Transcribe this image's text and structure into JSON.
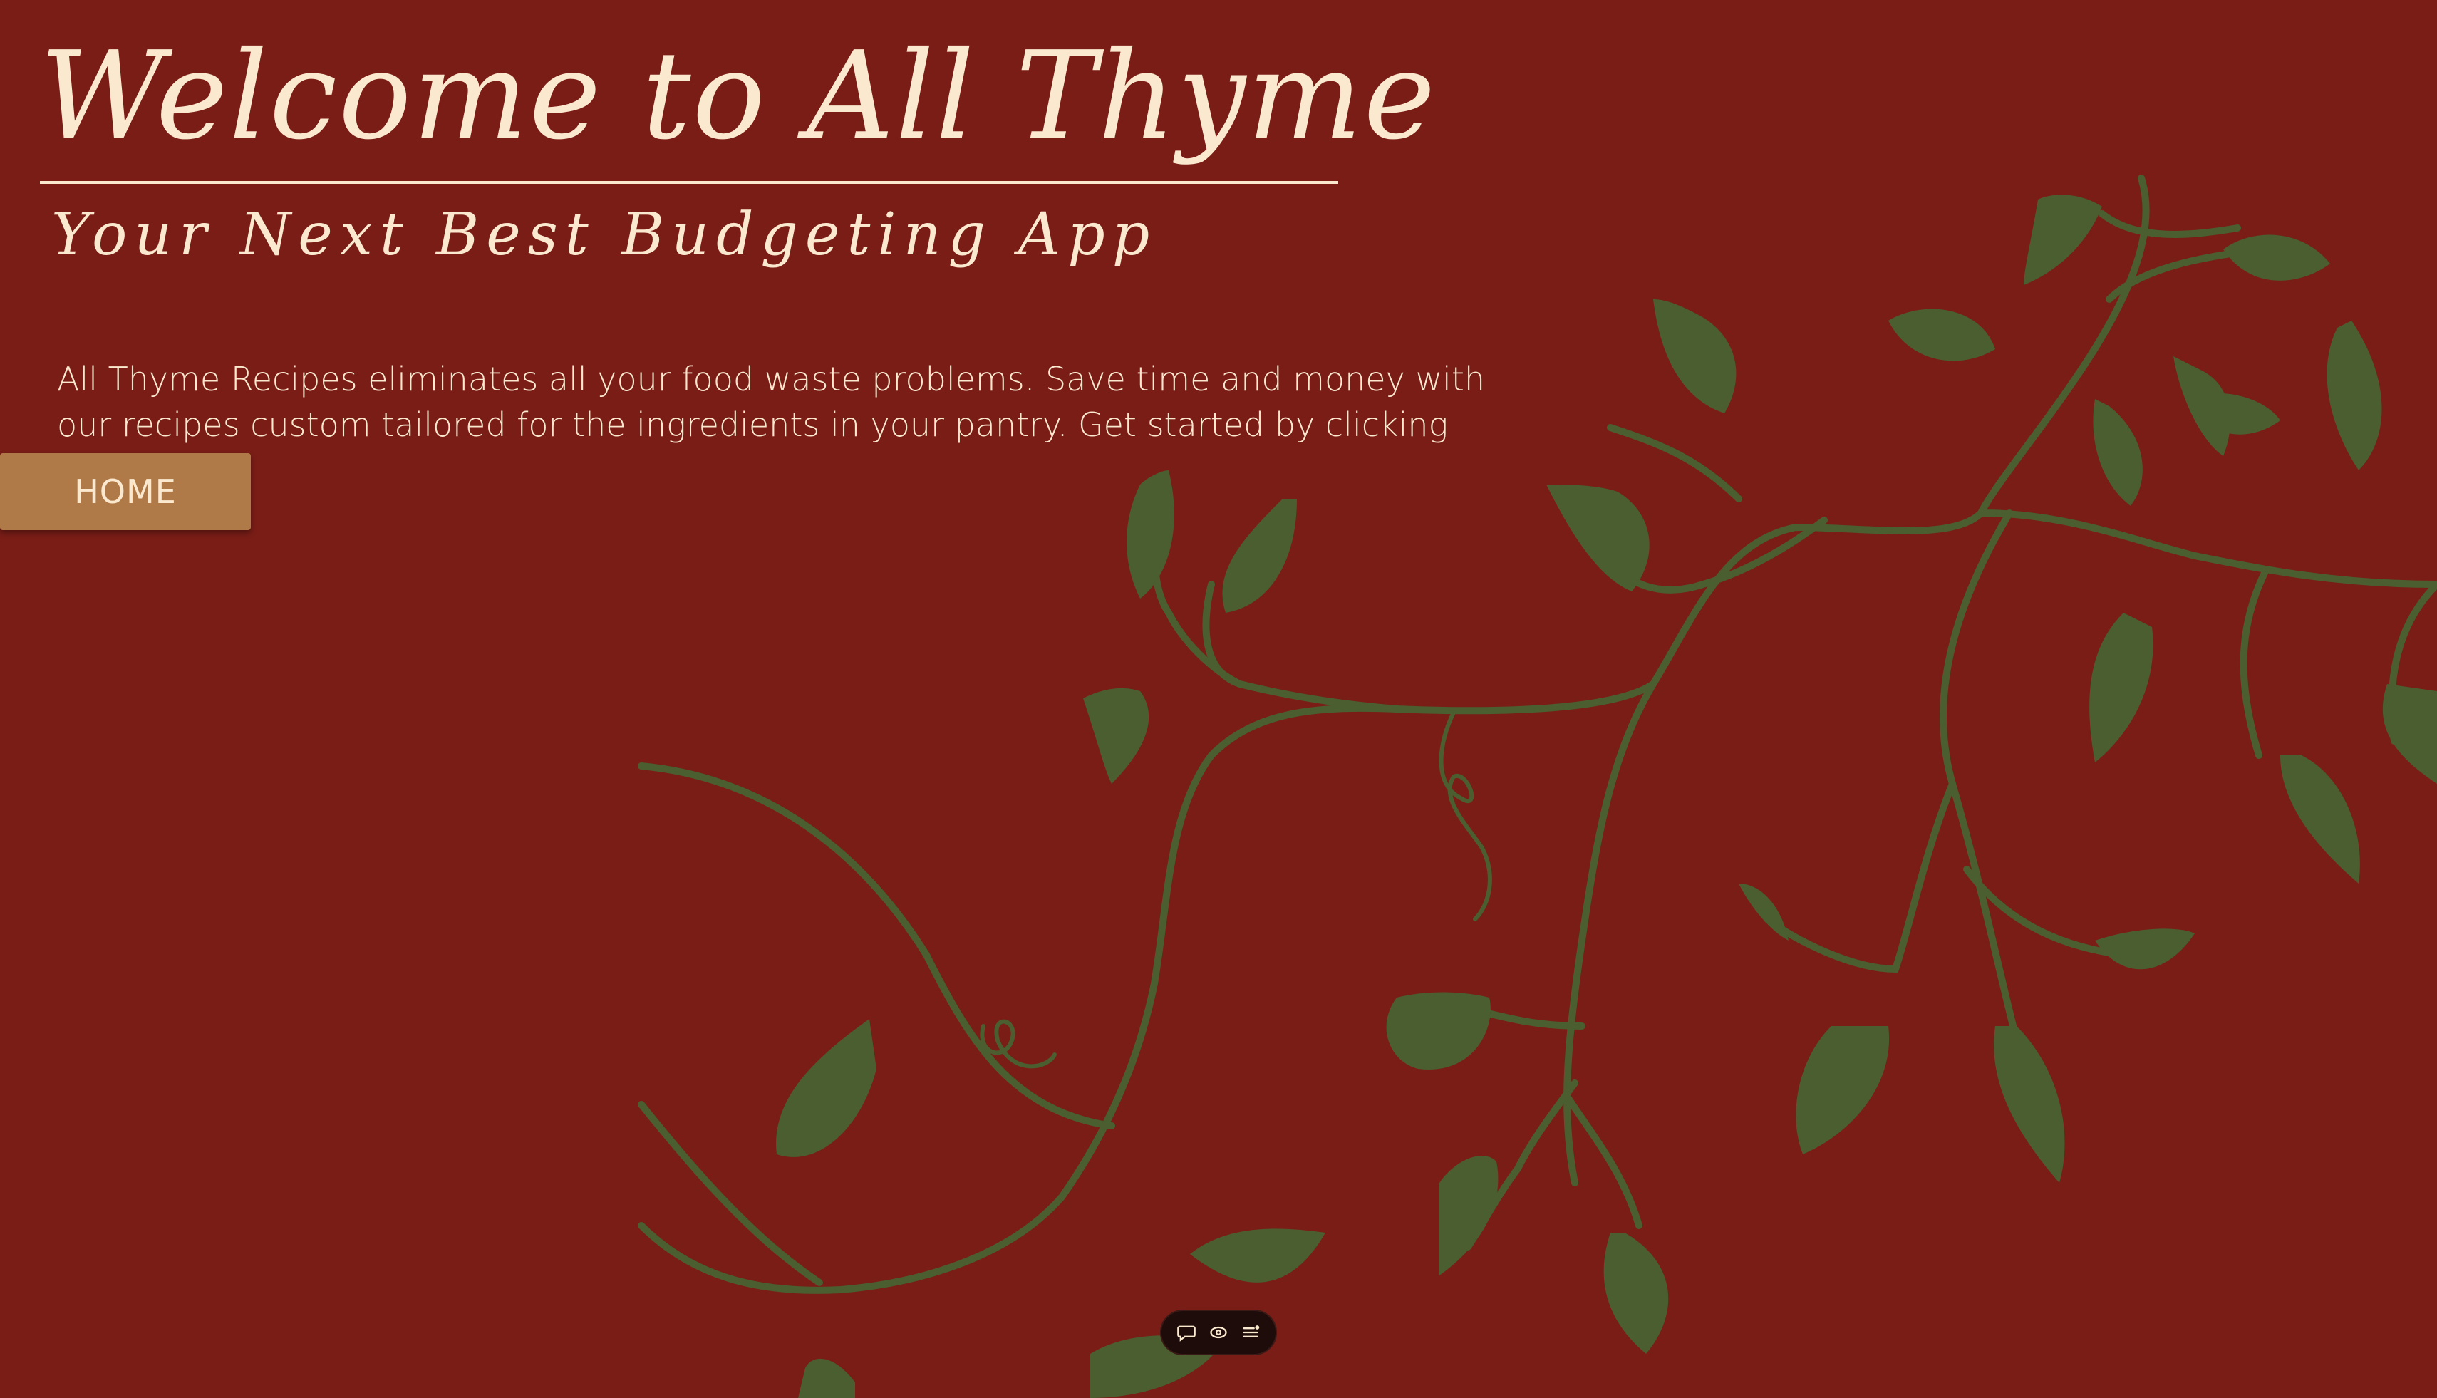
{
  "hero": {
    "title": "Welcome to All Thyme",
    "subtitle": "Your Next Best Budgeting App",
    "description": "All Thyme Recipes eliminates all your food waste problems. Save time and money with our recipes custom tailored for the ingredients in your pantry. Get started by clicking Home.",
    "home_button_label": "HOME"
  },
  "toolbar": {
    "icons": [
      "comment-icon",
      "eye-icon",
      "menu-icon"
    ]
  },
  "colors": {
    "background": "#7a1d17",
    "text": "#fbe9cf",
    "button": "#b07a48",
    "leaf": "#4a5e2f",
    "toolbar": "#1e0c0a"
  }
}
